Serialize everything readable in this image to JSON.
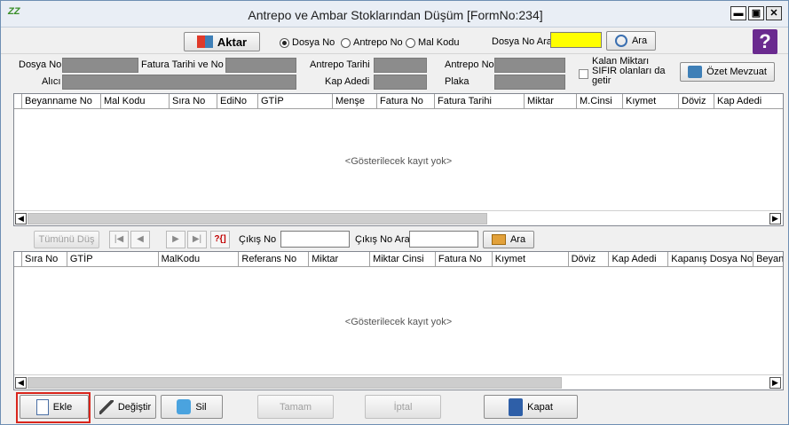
{
  "window": {
    "title": "Antrepo ve Ambar Stoklarından Düşüm [FormNo:234]",
    "app_icon_text": "ZZ",
    "min_glyph": "▬",
    "max_glyph": "▣",
    "close_glyph": "✕"
  },
  "toolbar": {
    "aktar_label": "Aktar",
    "radio_dosya": "Dosya No",
    "radio_antrepo": "Antrepo No",
    "radio_mal": "Mal Kodu",
    "dosya_no_ara_label": "Dosya No Ara",
    "search_value": "",
    "ara_label": "Ara",
    "help_glyph": "?"
  },
  "info": {
    "dosya_no": "Dosya No",
    "fatura_tarihi": "Fatura Tarihi ve No",
    "antrepo_tarihi": "Antrepo Tarihi",
    "antrepo_no": "Antrepo No",
    "kalan_line1": "Kalan Miktarı",
    "kalan_line2": "SIFIR olanları da",
    "kalan_line3": "getir",
    "ozet_mevzuat": "Özet Mevzuat",
    "alici": "Alıcı",
    "kap_adedi": "Kap Adedi",
    "plaka": "Plaka"
  },
  "grid1": {
    "columns": [
      "Beyanname No",
      "Mal Kodu",
      "Sıra No",
      "EdiNo",
      "GTİP",
      "Menşe",
      "Fatura No",
      "Fatura Tarihi",
      "Miktar",
      "M.Cinsi",
      "Kıymet",
      "Döviz",
      "Kap Adedi"
    ],
    "empty": "<Gösterilecek kayıt yok>"
  },
  "nav": {
    "tumunu_dus": "Tümünü Düş",
    "first": "|◀",
    "prev": "◀",
    "next": "▶",
    "last": "▶|",
    "special": "?{]",
    "cikis_no": "Çıkış No",
    "cikis_no_ara": "Çıkış No Ara",
    "ara": "Ara"
  },
  "grid2": {
    "columns": [
      "Sıra No",
      "GTİP",
      "MalKodu",
      "Referans No",
      "Miktar",
      "Miktar Cinsi",
      "Fatura No",
      "Kıymet",
      "Döviz",
      "Kap Adedi",
      "Kapanış Dosya No",
      "Beyan"
    ],
    "empty": "<Gösterilecek kayıt yok>"
  },
  "scroll": {
    "left": "◀",
    "right": "▶"
  },
  "bottom": {
    "ekle": "Ekle",
    "degistir": "Değiştir",
    "sil": "Sil",
    "tamam": "Tamam",
    "iptal": "İptal",
    "kapat": "Kapat"
  }
}
